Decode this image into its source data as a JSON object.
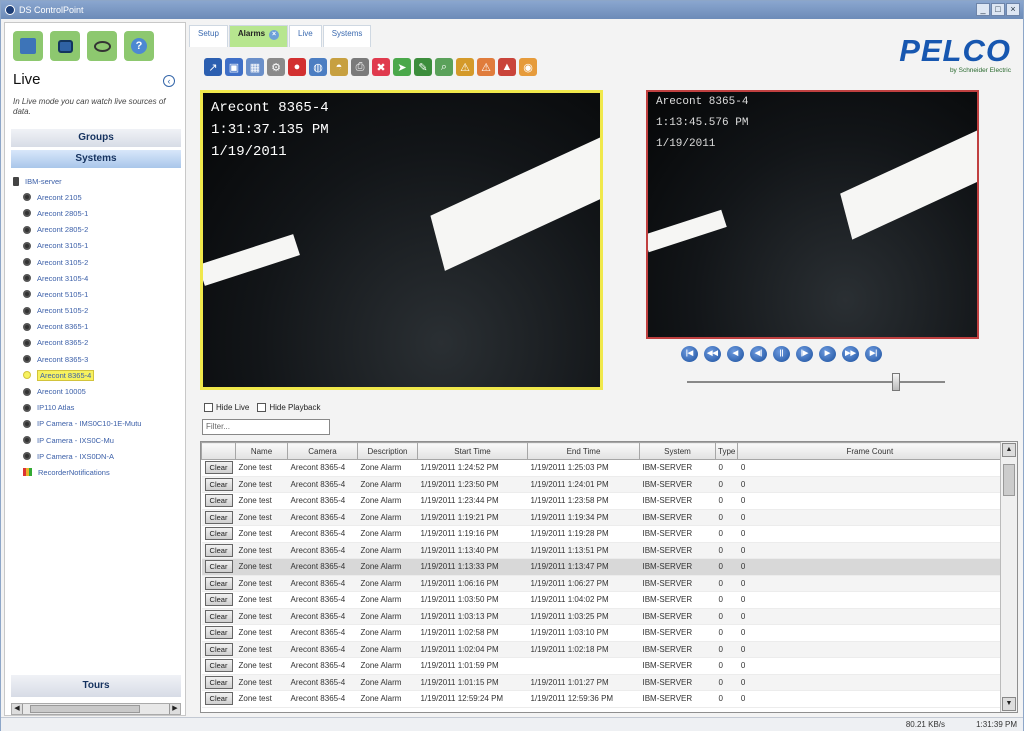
{
  "window": {
    "title": "DS ControlPoint",
    "buttons": [
      "_",
      "□",
      "×"
    ]
  },
  "sidebar": {
    "top_icons": [
      "network-icon",
      "monitor-icon",
      "binoculars-icon",
      "help-icon"
    ],
    "heading": "Live",
    "collapse_glyph": "‹",
    "description": "In Live mode you can watch live sources of data.",
    "groups_label": "Groups",
    "systems_label": "Systems",
    "tree": [
      {
        "label": "IBM-server",
        "kind": "server"
      },
      {
        "label": "Arecont 2105",
        "kind": "camera"
      },
      {
        "label": "Arecont 2805-1",
        "kind": "camera"
      },
      {
        "label": "Arecont 2805-2",
        "kind": "camera"
      },
      {
        "label": "Arecont 3105-1",
        "kind": "camera"
      },
      {
        "label": "Arecont 3105-2",
        "kind": "camera"
      },
      {
        "label": "Arecont 3105-4",
        "kind": "camera"
      },
      {
        "label": "Arecont 5105-1",
        "kind": "camera"
      },
      {
        "label": "Arecont 5105-2",
        "kind": "camera"
      },
      {
        "label": "Arecont 8365-1",
        "kind": "camera"
      },
      {
        "label": "Arecont 8365-2",
        "kind": "camera"
      },
      {
        "label": "Arecont 8365-3",
        "kind": "camera"
      },
      {
        "label": "Arecont 8365-4",
        "kind": "camera",
        "selected": true
      },
      {
        "label": "Arecont 10005",
        "kind": "camera"
      },
      {
        "label": "IP110 Atlas",
        "kind": "camera"
      },
      {
        "label": "IP Camera - IMS0C10-1E-Mutu",
        "kind": "camera"
      },
      {
        "label": "IP Camera - IXS0C-Mu",
        "kind": "camera"
      },
      {
        "label": "IP Camera - IXS0DN-A",
        "kind": "camera"
      },
      {
        "label": "RecorderNotifications",
        "kind": "notif"
      }
    ],
    "tours_label": "Tours"
  },
  "tabs": [
    {
      "label": "Setup",
      "active": false
    },
    {
      "label": "Alarms",
      "active": true,
      "closable": true
    },
    {
      "label": "Live",
      "active": false
    },
    {
      "label": "Systems",
      "active": false
    }
  ],
  "toolbar": {
    "icons": [
      {
        "name": "arrow-icon",
        "color": "#2c5fb0",
        "glyph": "↗"
      },
      {
        "name": "layout-single-icon",
        "color": "#3f6fc7",
        "glyph": "▣"
      },
      {
        "name": "layout-grid-icon",
        "color": "#6a8fc9",
        "glyph": "▦"
      },
      {
        "name": "settings-icon",
        "color": "#8a8a8a",
        "glyph": "⚙"
      },
      {
        "name": "record-icon",
        "color": "#d23030",
        "glyph": "●"
      },
      {
        "name": "globe-icon",
        "color": "#4c7ec2",
        "glyph": "◍"
      },
      {
        "name": "camera-icon",
        "color": "#c7a040",
        "glyph": "◓"
      },
      {
        "name": "print-icon",
        "color": "#7a7a7a",
        "glyph": "⎙"
      },
      {
        "name": "stop-icon",
        "color": "#e03a4e",
        "glyph": "✖"
      },
      {
        "name": "pointer-icon",
        "color": "#4aa84a",
        "glyph": "➤"
      },
      {
        "name": "edit-icon",
        "color": "#3c8d3c",
        "glyph": "✎"
      },
      {
        "name": "search-icon",
        "color": "#5aa15a",
        "glyph": "⌕"
      },
      {
        "name": "warning-icon",
        "color": "#d49a2a",
        "glyph": "⚠"
      },
      {
        "name": "alarm-icon",
        "color": "#e07c3c",
        "glyph": "⚠"
      },
      {
        "name": "siren-icon",
        "color": "#c9443a",
        "glyph": "▲"
      },
      {
        "name": "speaker-icon",
        "color": "#e69b3b",
        "glyph": "◉"
      }
    ]
  },
  "logo": {
    "brand": "PELCO",
    "sub": "by Schneider Electric"
  },
  "video_left": {
    "camera": "Arecont 8365-4",
    "time": "1:31:37.135 PM",
    "date": "1/19/2011"
  },
  "video_right": {
    "camera": "Arecont 8365-4",
    "time": "1:13:45.576 PM",
    "date": "1/19/2011"
  },
  "playback": {
    "buttons": [
      {
        "name": "skip-start-icon",
        "glyph": "|◀"
      },
      {
        "name": "rewind-fast-icon",
        "glyph": "◀◀"
      },
      {
        "name": "step-back-icon",
        "glyph": "◀"
      },
      {
        "name": "frame-back-icon",
        "glyph": "◀|"
      },
      {
        "name": "pause-icon",
        "glyph": "||"
      },
      {
        "name": "frame-forward-icon",
        "glyph": "|▶"
      },
      {
        "name": "play-icon",
        "glyph": "▶"
      },
      {
        "name": "fast-forward-icon",
        "glyph": "▶▶"
      },
      {
        "name": "skip-end-icon",
        "glyph": "▶|"
      }
    ],
    "position": 0.81
  },
  "options": {
    "hide_live": "Hide Live",
    "hide_playback": "Hide Playback"
  },
  "filter": {
    "placeholder": "Filter..."
  },
  "grid": {
    "columns": [
      "",
      "Name",
      "Camera",
      "Description",
      "Start Time",
      "End Time",
      "System",
      "Type",
      "Frame Count"
    ],
    "clear_label": "Clear",
    "rows": [
      [
        "Zone test",
        "Arecont 8365-4",
        "Zone Alarm",
        "1/19/2011 1:24:52 PM",
        "1/19/2011 1:25:03 PM",
        "IBM-SERVER",
        "0",
        "0"
      ],
      [
        "Zone test",
        "Arecont 8365-4",
        "Zone Alarm",
        "1/19/2011 1:23:50 PM",
        "1/19/2011 1:24:01 PM",
        "IBM-SERVER",
        "0",
        "0"
      ],
      [
        "Zone test",
        "Arecont 8365-4",
        "Zone Alarm",
        "1/19/2011 1:23:44 PM",
        "1/19/2011 1:23:58 PM",
        "IBM-SERVER",
        "0",
        "0"
      ],
      [
        "Zone test",
        "Arecont 8365-4",
        "Zone Alarm",
        "1/19/2011 1:19:21 PM",
        "1/19/2011 1:19:34 PM",
        "IBM-SERVER",
        "0",
        "0"
      ],
      [
        "Zone test",
        "Arecont 8365-4",
        "Zone Alarm",
        "1/19/2011 1:19:16 PM",
        "1/19/2011 1:19:28 PM",
        "IBM-SERVER",
        "0",
        "0"
      ],
      [
        "Zone test",
        "Arecont 8365-4",
        "Zone Alarm",
        "1/19/2011 1:13:40 PM",
        "1/19/2011 1:13:51 PM",
        "IBM-SERVER",
        "0",
        "0"
      ],
      [
        "Zone test",
        "Arecont 8365-4",
        "Zone Alarm",
        "1/19/2011 1:13:33 PM",
        "1/19/2011 1:13:47 PM",
        "IBM-SERVER",
        "0",
        "0"
      ],
      [
        "Zone test",
        "Arecont 8365-4",
        "Zone Alarm",
        "1/19/2011 1:06:16 PM",
        "1/19/2011 1:06:27 PM",
        "IBM-SERVER",
        "0",
        "0"
      ],
      [
        "Zone test",
        "Arecont 8365-4",
        "Zone Alarm",
        "1/19/2011 1:03:50 PM",
        "1/19/2011 1:04:02 PM",
        "IBM-SERVER",
        "0",
        "0"
      ],
      [
        "Zone test",
        "Arecont 8365-4",
        "Zone Alarm",
        "1/19/2011 1:03:13 PM",
        "1/19/2011 1:03:25 PM",
        "IBM-SERVER",
        "0",
        "0"
      ],
      [
        "Zone test",
        "Arecont 8365-4",
        "Zone Alarm",
        "1/19/2011 1:02:58 PM",
        "1/19/2011 1:03:10 PM",
        "IBM-SERVER",
        "0",
        "0"
      ],
      [
        "Zone test",
        "Arecont 8365-4",
        "Zone Alarm",
        "1/19/2011 1:02:04 PM",
        "1/19/2011 1:02:18 PM",
        "IBM-SERVER",
        "0",
        "0"
      ],
      [
        "Zone test",
        "Arecont 8365-4",
        "Zone Alarm",
        "1/19/2011 1:01:59 PM",
        "",
        "IBM-SERVER",
        "0",
        "0"
      ],
      [
        "Zone test",
        "Arecont 8365-4",
        "Zone Alarm",
        "1/19/2011 1:01:15 PM",
        "1/19/2011 1:01:27 PM",
        "IBM-SERVER",
        "0",
        "0"
      ],
      [
        "Zone test",
        "Arecont 8365-4",
        "Zone Alarm",
        "1/19/2011 12:59:24 PM",
        "1/19/2011 12:59:36 PM",
        "IBM-SERVER",
        "0",
        "0"
      ]
    ],
    "highlighted_row": 6
  },
  "status": {
    "rate": "80.21 KB/s",
    "clock": "1:31:39 PM"
  }
}
